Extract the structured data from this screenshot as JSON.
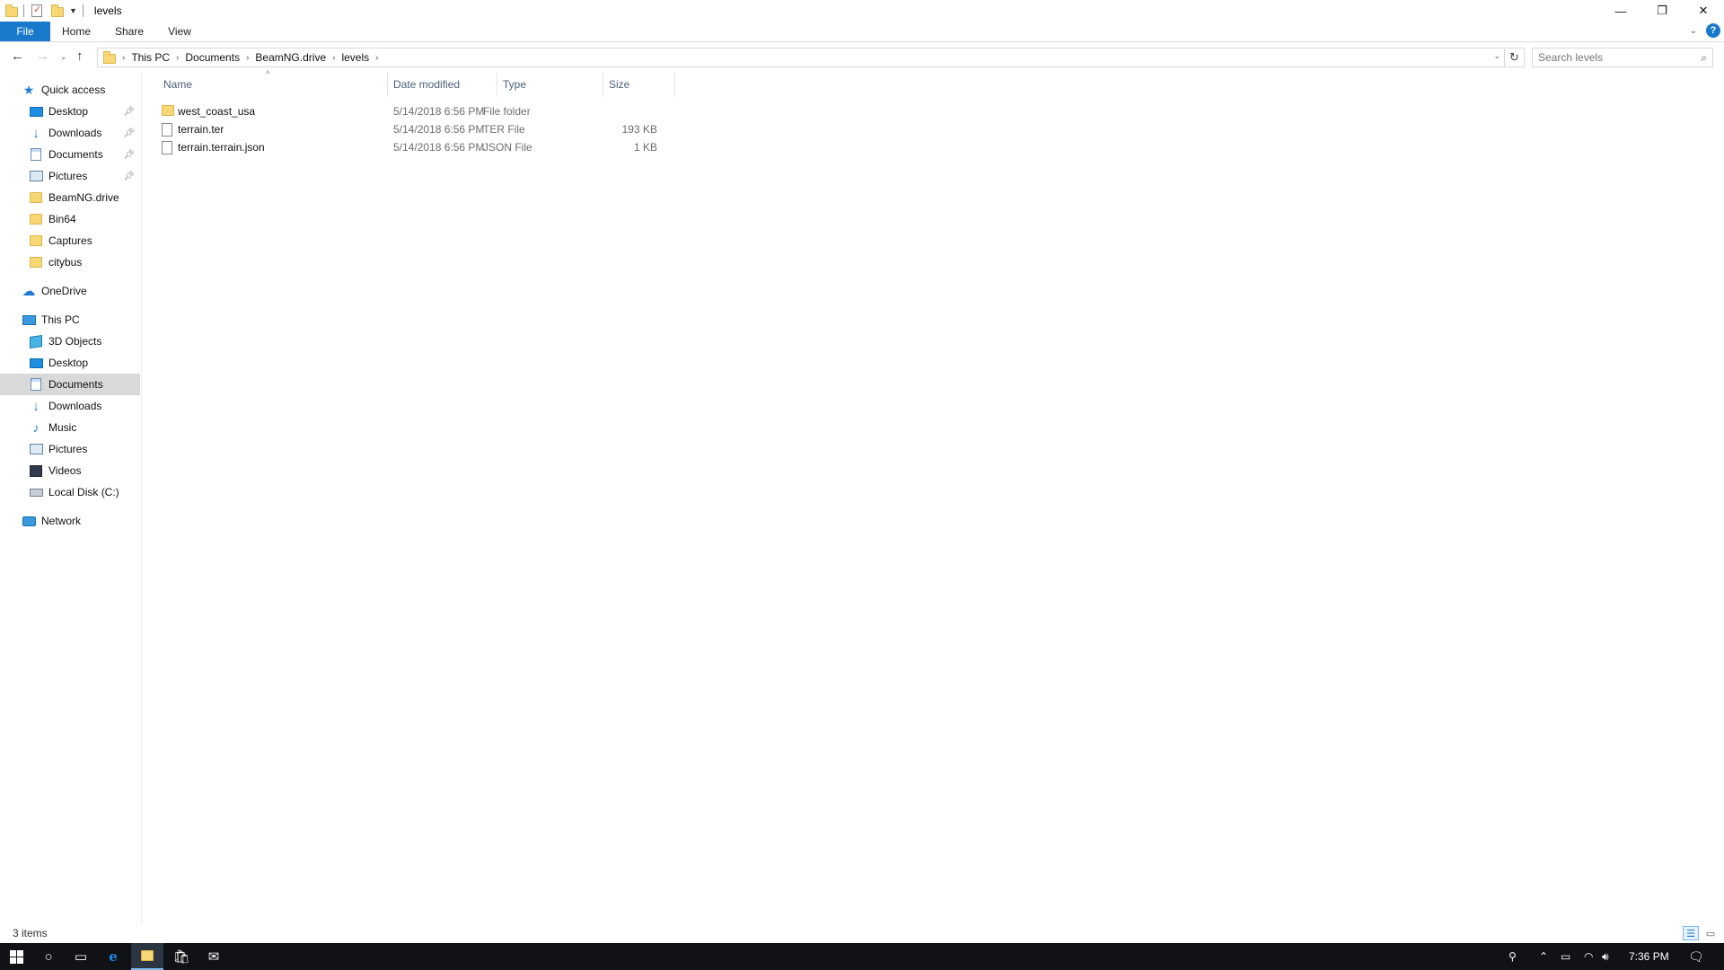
{
  "window": {
    "title": "levels",
    "controls": {
      "minimize": "—",
      "maximize": "❐",
      "close": "✕"
    }
  },
  "ribbon": {
    "tabs": [
      "File",
      "Home",
      "Share",
      "View"
    ],
    "help": "?"
  },
  "address": {
    "crumbs": [
      "This PC",
      "Documents",
      "BeamNG.drive",
      "levels"
    ],
    "search_placeholder": "Search levels"
  },
  "nav": {
    "quick_access": "Quick access",
    "quick_items": [
      "Desktop",
      "Downloads",
      "Documents",
      "Pictures",
      "BeamNG.drive",
      "Bin64",
      "Captures",
      "citybus"
    ],
    "onedrive": "OneDrive",
    "this_pc": "This PC",
    "pc_items": [
      "3D Objects",
      "Desktop",
      "Documents",
      "Downloads",
      "Music",
      "Pictures",
      "Videos",
      "Local Disk (C:)"
    ],
    "network": "Network",
    "selected": "Documents"
  },
  "columns": [
    "Name",
    "Date modified",
    "Type",
    "Size"
  ],
  "files": [
    {
      "name": "west_coast_usa",
      "date": "5/14/2018 6:56 PM",
      "type": "File folder",
      "size": "",
      "kind": "folder"
    },
    {
      "name": "terrain.ter",
      "date": "5/14/2018 6:56 PM",
      "type": "TER File",
      "size": "193 KB",
      "kind": "file"
    },
    {
      "name": "terrain.terrain.json",
      "date": "5/14/2018 6:56 PM",
      "type": "JSON File",
      "size": "1 KB",
      "kind": "file"
    }
  ],
  "status": {
    "count": "3 items"
  },
  "taskbar": {
    "clock": "7:36 PM"
  },
  "colors": {
    "accent": "#1979ca",
    "folder": "#f8d775",
    "selected_nav": "#d9d9d9",
    "taskbar": "#101216"
  }
}
